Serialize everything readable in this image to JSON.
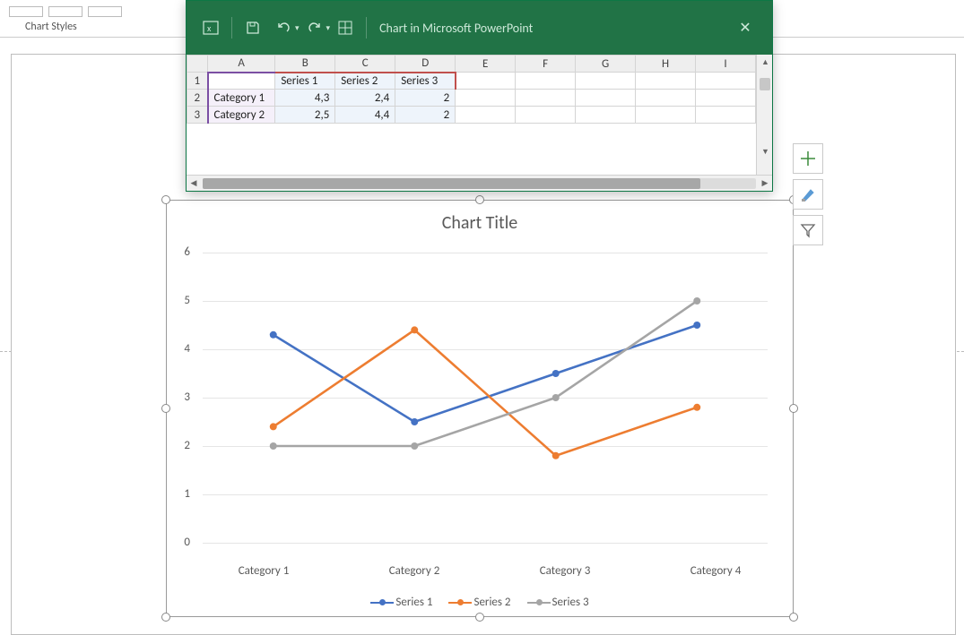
{
  "ribbon": {
    "group_label": "Chart Styles"
  },
  "data_window": {
    "title": "Chart in Microsoft PowerPoint",
    "columns": [
      "A",
      "B",
      "C",
      "D",
      "E",
      "F",
      "G",
      "H",
      "I"
    ],
    "rows": [
      {
        "n": "1",
        "cells": [
          "",
          "Series 1",
          "Series 2",
          "Series 3",
          "",
          "",
          "",
          "",
          ""
        ]
      },
      {
        "n": "2",
        "cells": [
          "Category 1",
          "4,3",
          "2,4",
          "2",
          "",
          "",
          "",
          "",
          ""
        ]
      },
      {
        "n": "3",
        "cells": [
          "Category 2",
          "2,5",
          "4,4",
          "2",
          "",
          "",
          "",
          "",
          ""
        ]
      }
    ]
  },
  "chart": {
    "title": "Chart Title",
    "y_ticks": [
      "0",
      "1",
      "2",
      "3",
      "4",
      "5",
      "6"
    ],
    "x_labels": [
      "Category 1",
      "Category 2",
      "Category 3",
      "Category 4"
    ],
    "legend": [
      "Series 1",
      "Series 2",
      "Series 3"
    ]
  },
  "chart_data": {
    "type": "line",
    "title": "Chart Title",
    "xlabel": "",
    "ylabel": "",
    "ylim": [
      0,
      6
    ],
    "categories": [
      "Category 1",
      "Category 2",
      "Category 3",
      "Category 4"
    ],
    "series": [
      {
        "name": "Series 1",
        "color": "#4472c4",
        "values": [
          4.3,
          2.5,
          3.5,
          4.5
        ]
      },
      {
        "name": "Series 2",
        "color": "#ed7d31",
        "values": [
          2.4,
          4.4,
          1.8,
          2.8
        ]
      },
      {
        "name": "Series 3",
        "color": "#a5a5a5",
        "values": [
          2.0,
          2.0,
          3.0,
          5.0
        ]
      }
    ]
  },
  "colors": {
    "series1": "#4472c4",
    "series2": "#ed7d31",
    "series3": "#a5a5a5"
  }
}
